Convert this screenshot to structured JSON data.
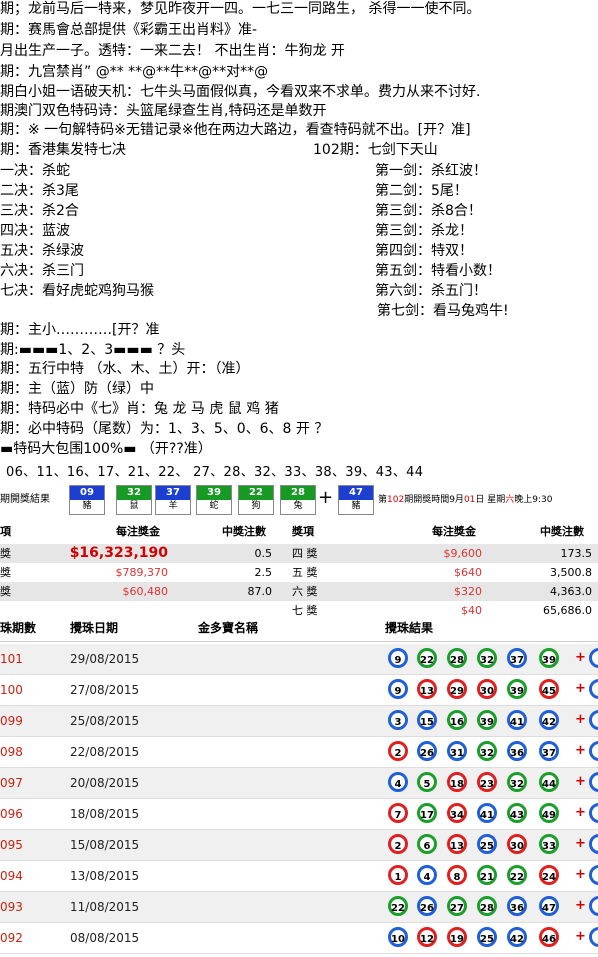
{
  "lines": [
    {
      "text": "期；龙前马后一特来，梦见昨夜开一四。一七三一同路生，  杀得一一使不同。"
    },
    {
      "text": "期：赛馬會总部提供《彩霸王出肖料》准-"
    },
    {
      "text": "月出生产一子。透特：一来二去！  不出生肖：牛狗龙 开"
    },
    {
      "text": "期：九宫禁肖”  @** **@**牛**@**对**@"
    },
    {
      "text": "期白小姐一语破天机：七牛头马面假似真，今看双来不求单。费力从来不讨好."
    },
    {
      "text": "期澳门双色特码诗：头篮尾绿查生肖,特码还是单数开"
    },
    {
      "text": "期：※ 一句解特码※无错记录※他在两边大路边，看查特码就不出。[开？准]"
    }
  ],
  "seven": {
    "left_title": "期：香港集发特七决",
    "right_title": "102期：七剑下天山",
    "left": [
      "一决：杀蛇",
      "二决：杀3尾",
      "三决：杀2合",
      "四决：蓝波",
      "五决：杀绿波",
      "六决：杀三门",
      "七决：看好虎蛇鸡狗马猴"
    ],
    "right": [
      "第一剑：杀红波！",
      "第二剑：5尾！",
      "第三剑：杀8合！",
      "第三剑：杀龙！",
      "第四剑：特双！",
      "第五剑：特看小数！",
      "第六剑：杀五门！",
      "第七剑：看马兔鸡牛!"
    ]
  },
  "lines2": [
    "期：主小…………[开？准",
    "期:▬▬▬1、2、3▬▬▬ ？头",
    "期：五行中特  （水、木、土）开：（准）",
    "期：主（蓝）防（绿）中",
    "期：特码必中《七》肖：兔 龙 马 虎 鼠 鸡  猪",
    "期：必中特码（尾数）为：1、3、5、0、6、8    开 ？",
    "▬特码大包围100%▬ （开??准）"
  ],
  "numbers": "06、11、16、17、21、22、 27、28、32、33、38、39、43、44",
  "draw": {
    "title": "期開獎結果",
    "balls": [
      {
        "n": "09",
        "z": "豬",
        "c": "blue"
      },
      {
        "n": "32",
        "z": "鼠",
        "c": "green"
      },
      {
        "n": "37",
        "z": "羊",
        "c": "blue"
      },
      {
        "n": "39",
        "z": "蛇",
        "c": "green"
      },
      {
        "n": "22",
        "z": "狗",
        "c": "green"
      },
      {
        "n": "28",
        "z": "兔",
        "c": "green"
      }
    ],
    "special": {
      "n": "47",
      "z": "豬",
      "c": "blue"
    },
    "plus": "+",
    "next_pre": "第",
    "next_no": "102",
    "next_mid": "期開獎時間9月",
    "next_day": "01",
    "next_mid2": "日 星期",
    "next_week": "六",
    "next_end": "晚上9:30"
  },
  "prize": {
    "h1": "項",
    "h2": "每注獎金",
    "h3": "中獎注數",
    "h4": "獎項",
    "h5": "每注獎金",
    "h6": "中獎注數",
    "left": [
      {
        "k": "獎",
        "money": "$16,323,190",
        "cnt": "0.5"
      },
      {
        "k": "獎",
        "money": "$789,370",
        "cnt": "2.5"
      },
      {
        "k": "獎",
        "money": "$60,480",
        "cnt": "87.0"
      }
    ],
    "right": [
      {
        "k": "四 獎",
        "money": "$9,600",
        "cnt": "173.5"
      },
      {
        "k": "五 獎",
        "money": "$640",
        "cnt": "3,500.8"
      },
      {
        "k": "六 獎",
        "money": "$320",
        "cnt": "4,363.0"
      },
      {
        "k": "七 獎",
        "money": "$40",
        "cnt": "65,686.0"
      }
    ]
  },
  "history": {
    "h1": "珠期數",
    "h2": "攪珠日期",
    "h3": "金多寶名稱",
    "h4": "攪珠結果",
    "rows": [
      {
        "no": "101",
        "date": "29/08/2015",
        "balls": [
          [
            "9",
            "b"
          ],
          [
            "22",
            "g"
          ],
          [
            "28",
            "g"
          ],
          [
            "32",
            "g"
          ],
          [
            "37",
            "b"
          ],
          [
            "39",
            "g"
          ]
        ]
      },
      {
        "no": "100",
        "date": "27/08/2015",
        "balls": [
          [
            "9",
            "b"
          ],
          [
            "13",
            "r"
          ],
          [
            "29",
            "r"
          ],
          [
            "30",
            "r"
          ],
          [
            "39",
            "g"
          ],
          [
            "45",
            "r"
          ]
        ]
      },
      {
        "no": "099",
        "date": "25/08/2015",
        "balls": [
          [
            "3",
            "b"
          ],
          [
            "15",
            "b"
          ],
          [
            "16",
            "g"
          ],
          [
            "39",
            "g"
          ],
          [
            "41",
            "b"
          ],
          [
            "42",
            "b"
          ]
        ]
      },
      {
        "no": "098",
        "date": "22/08/2015",
        "balls": [
          [
            "2",
            "r"
          ],
          [
            "26",
            "b"
          ],
          [
            "31",
            "b"
          ],
          [
            "32",
            "g"
          ],
          [
            "36",
            "b"
          ],
          [
            "37",
            "b"
          ]
        ]
      },
      {
        "no": "097",
        "date": "20/08/2015",
        "balls": [
          [
            "4",
            "b"
          ],
          [
            "5",
            "g"
          ],
          [
            "18",
            "r"
          ],
          [
            "23",
            "r"
          ],
          [
            "32",
            "g"
          ],
          [
            "44",
            "g"
          ]
        ]
      },
      {
        "no": "096",
        "date": "18/08/2015",
        "balls": [
          [
            "7",
            "r"
          ],
          [
            "17",
            "g"
          ],
          [
            "34",
            "r"
          ],
          [
            "41",
            "b"
          ],
          [
            "43",
            "g"
          ],
          [
            "49",
            "g"
          ]
        ]
      },
      {
        "no": "095",
        "date": "15/08/2015",
        "balls": [
          [
            "2",
            "r"
          ],
          [
            "6",
            "g"
          ],
          [
            "13",
            "r"
          ],
          [
            "25",
            "b"
          ],
          [
            "30",
            "r"
          ],
          [
            "33",
            "g"
          ]
        ]
      },
      {
        "no": "094",
        "date": "13/08/2015",
        "balls": [
          [
            "1",
            "r"
          ],
          [
            "4",
            "b"
          ],
          [
            "8",
            "r"
          ],
          [
            "21",
            "g"
          ],
          [
            "22",
            "g"
          ],
          [
            "24",
            "r"
          ]
        ]
      },
      {
        "no": "093",
        "date": "11/08/2015",
        "balls": [
          [
            "22",
            "g"
          ],
          [
            "26",
            "b"
          ],
          [
            "27",
            "g"
          ],
          [
            "28",
            "g"
          ],
          [
            "36",
            "b"
          ],
          [
            "47",
            "b"
          ]
        ]
      },
      {
        "no": "092",
        "date": "08/08/2015",
        "balls": [
          [
            "10",
            "b"
          ],
          [
            "12",
            "r"
          ],
          [
            "19",
            "r"
          ],
          [
            "25",
            "b"
          ],
          [
            "42",
            "b"
          ],
          [
            "46",
            "r"
          ]
        ]
      }
    ],
    "plus": "+"
  }
}
